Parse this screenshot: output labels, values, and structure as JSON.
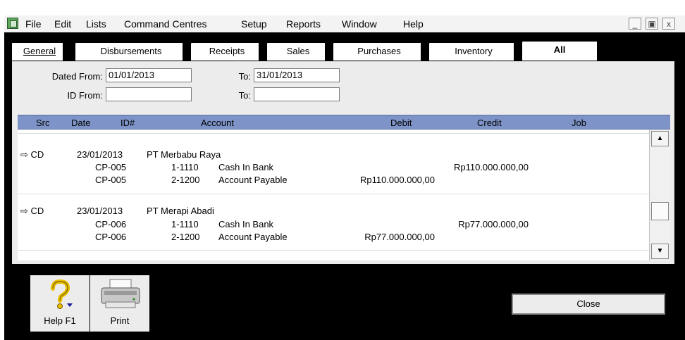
{
  "menubar": {
    "items": [
      "File",
      "Edit",
      "Lists",
      "Command Centres",
      "Setup",
      "Reports",
      "Window",
      "Help"
    ],
    "controls": [
      "_",
      "ฑ",
      "x"
    ]
  },
  "tabs": [
    "General",
    "Disbursements",
    "Receipts",
    "Sales",
    "Purchases",
    "Inventory",
    "All"
  ],
  "active_tab": "All",
  "filters": {
    "dated_from_label": "Dated From:",
    "dated_from": "01/01/2013",
    "dated_to_label": "To:",
    "dated_to": "31/01/2013",
    "id_from_label": "ID From:",
    "id_from": "",
    "id_to_label": "To:",
    "id_to": ""
  },
  "columns": [
    "Src",
    "Date",
    "ID#",
    "Account",
    "Debit",
    "Credit",
    "Job"
  ],
  "transactions": [
    {
      "src": "⇨ CD",
      "date": "23/01/2013",
      "name": "PT Merbabu Raya",
      "lines": [
        {
          "id": "CP-005",
          "acct_no": "1-1110",
          "acct_name": "Cash In Bank",
          "debit": "",
          "credit": "Rp110.000.000,00"
        },
        {
          "id": "CP-005",
          "acct_no": "2-1200",
          "acct_name": "Account Payable",
          "debit": "Rp110.000.000,00",
          "credit": ""
        }
      ]
    },
    {
      "src": "⇨ CD",
      "date": "23/01/2013",
      "name": "PT Merapi Abadi",
      "lines": [
        {
          "id": "CP-006",
          "acct_no": "1-1110",
          "acct_name": "Cash In Bank",
          "debit": "",
          "credit": "Rp77.000.000,00"
        },
        {
          "id": "CP-006",
          "acct_no": "2-1200",
          "acct_name": "Account Payable",
          "debit": "Rp77.000.000,00",
          "credit": ""
        }
      ]
    }
  ],
  "buttons": {
    "help": "Help F1",
    "print": "Print",
    "close": "Close"
  },
  "icons": {
    "app": "app-icon",
    "help": "question-mark-icon",
    "print": "printer-icon",
    "scroll_up": "scroll-up-arrow-icon",
    "scroll_down": "scroll-down-arrow-icon",
    "row_marker": "arrow-right-icon"
  }
}
